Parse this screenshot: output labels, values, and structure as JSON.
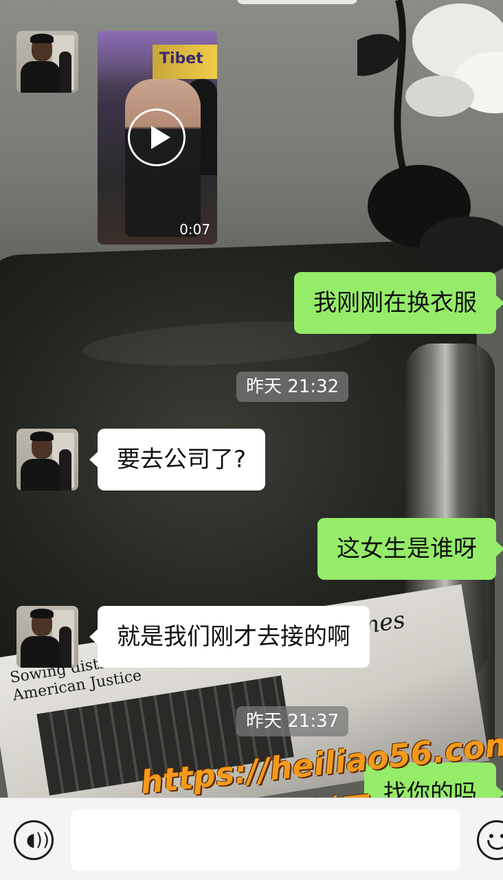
{
  "chat": {
    "video_duration": "0:07",
    "video_sign_text": "Tibet",
    "messages": [
      {
        "from": "me",
        "text": "我刚刚在换衣服"
      },
      {
        "from": "time",
        "text": "昨天 21:32"
      },
      {
        "from": "them",
        "text": "要去公司了?"
      },
      {
        "from": "me",
        "text": "这女生是谁呀"
      },
      {
        "from": "them",
        "text": "就是我们刚才去接的啊"
      },
      {
        "from": "time",
        "text": "昨天 21:37"
      },
      {
        "from": "me",
        "text": "找你的吗"
      }
    ]
  },
  "watermark": {
    "url": "https://heiliao56.com",
    "site_name": "黑料网"
  },
  "newspaper": {
    "masthead": "New York Times",
    "headline": "Sowing distrus in American Justice"
  },
  "input_bar": {
    "voice_icon": "voice-icon",
    "emoji_icon": "emoji-icon"
  }
}
